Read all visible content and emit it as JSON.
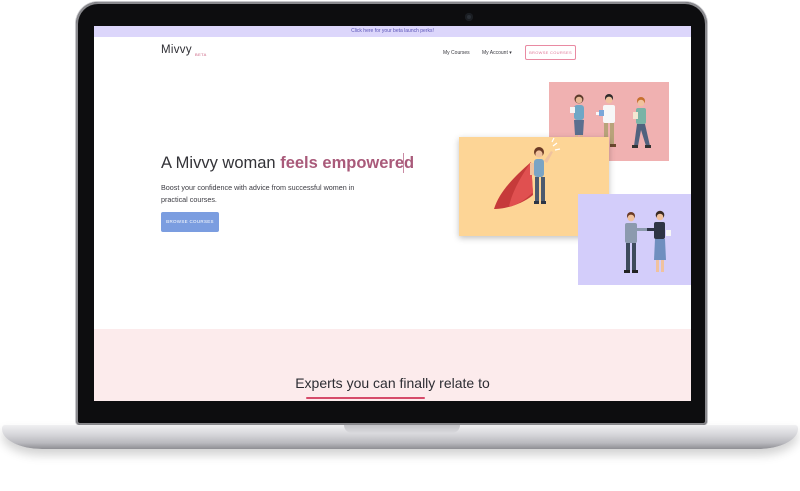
{
  "promo": {
    "text": "Click here for your beta launch perks!"
  },
  "nav": {
    "logo": "Mivvy",
    "beta": "BETA",
    "my_courses": "My Courses",
    "my_account": "My Account ▾",
    "browse": "BROWSE COURSES"
  },
  "hero": {
    "title_prefix": "A Mivvy woman ",
    "title_accent": "feels empowered",
    "subtitle": "Boost your confidence with advice from successful women in practical courses.",
    "button": "BROWSE COURSES"
  },
  "section2": {
    "heading": "Experts you can finally relate to"
  },
  "colors": {
    "promo_bg": "#dcd6fb",
    "accent": "#a95a7a",
    "button_blue": "#7b9de0",
    "card_pink": "#f0b1b1",
    "card_yellow": "#fdd596",
    "card_lavender": "#d3cdfa",
    "section_bg": "#fcebec"
  }
}
